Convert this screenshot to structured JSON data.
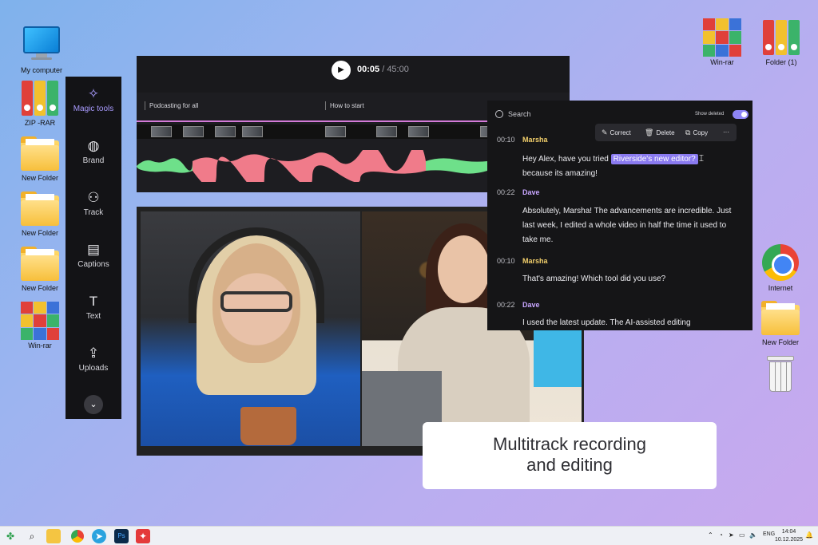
{
  "desktop": {
    "left_icons": [
      {
        "label": "My computer",
        "icon": "monitor-icon"
      },
      {
        "label": "ZIP -RAR",
        "icon": "binders-icon"
      },
      {
        "label": "New Folder",
        "icon": "folder-icon"
      },
      {
        "label": "New Folder",
        "icon": "folder-icon"
      },
      {
        "label": "New Folder",
        "icon": "folder-icon"
      },
      {
        "label": "Win-rar",
        "icon": "winrar-icon"
      }
    ],
    "right_icons": [
      {
        "label": "Win-rar",
        "icon": "winrar-icon"
      },
      {
        "label": "Folder (1)",
        "icon": "binders-icon"
      },
      {
        "label": "Internet",
        "icon": "chrome-icon"
      },
      {
        "label": "New Folder",
        "icon": "folder-icon"
      },
      {
        "label": "",
        "icon": "recycle-bin-icon"
      }
    ]
  },
  "sidebar": {
    "items": [
      {
        "label": "Magic tools",
        "icon": "sparkles-icon",
        "active": true
      },
      {
        "label": "Brand",
        "icon": "palette-icon"
      },
      {
        "label": "Track",
        "icon": "people-icon"
      },
      {
        "label": "Captions",
        "icon": "captions-icon"
      },
      {
        "label": "Text",
        "icon": "text-icon"
      },
      {
        "label": "Uploads",
        "icon": "upload-icon"
      }
    ],
    "more_icon": "chevron-down-icon"
  },
  "player": {
    "current_time": "00:05",
    "total_time": "/ 45:00",
    "sections": [
      "Podcasting for all",
      "How to start"
    ]
  },
  "transcript": {
    "search_placeholder": "Search",
    "show_deleted_label": "Show deleted",
    "toolbar": {
      "correct": "Correct",
      "delete": "Delete",
      "copy": "Copy",
      "more": "···"
    },
    "entries": [
      {
        "time": "00:10",
        "speaker": "Marsha",
        "pre": "Hey Alex, have you tried",
        "highlight": "Riverside's new editor?",
        "post": "because its amazing!"
      },
      {
        "time": "00:22",
        "speaker": "Dave",
        "text": "Absolutely, Marsha! The advancements are incredible. Just last week, I edited a whole video in half the time it used to take me."
      },
      {
        "time": "00:10",
        "speaker": "Marsha",
        "text": "That's amazing! Which tool did you use?"
      },
      {
        "time": "00:22",
        "speaker": "Dave",
        "text": "I used the latest update. The AI-assisted editing"
      }
    ],
    "colors": {
      "marsha": "#f2cf6b",
      "dave": "#c8a6ff",
      "highlight": "#8a7af0"
    }
  },
  "caption": {
    "line1": "Multitrack recording",
    "line2": "and editing"
  },
  "taskbar": {
    "language": "ENG",
    "time": "14:04",
    "date": "10.12.2025"
  }
}
